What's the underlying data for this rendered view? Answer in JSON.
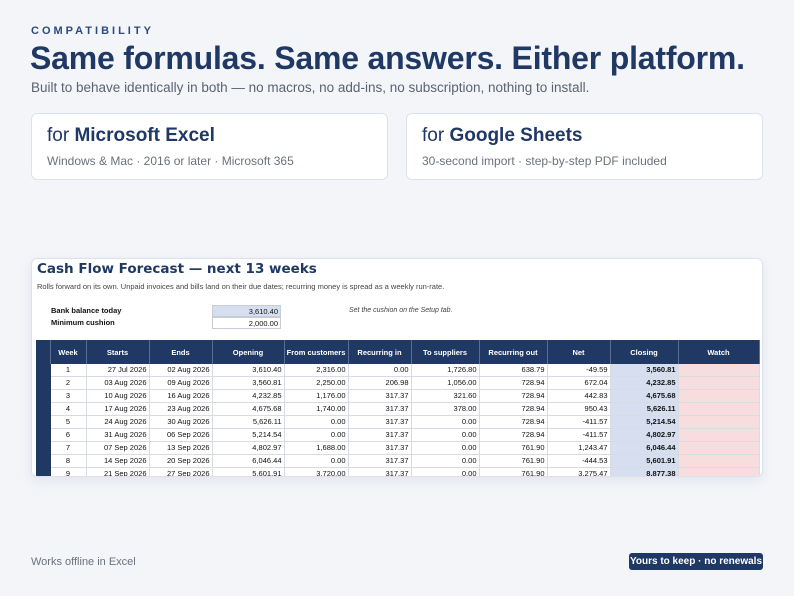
{
  "header": {
    "eyebrow": "COMPATIBILITY",
    "headline": "Same formulas. Same answers. Either platform.",
    "subline": "Built to behave identically in both — no macros, no add-ins, no subscription, nothing to install."
  },
  "cards": [
    {
      "prefix": "for ",
      "product": "Microsoft Excel",
      "sub": "Windows & Mac · 2016 or later · Microsoft 365"
    },
    {
      "prefix": "for ",
      "product": "Google Sheets",
      "sub": "30-second import · step-by-step PDF included"
    }
  ],
  "sheet": {
    "title": "Cash Flow Forecast — next 13 weeks",
    "description": "Rolls forward on its own. Unpaid invoices and bills land on their due dates; recurring money is spread as a weekly run-rate.",
    "bank_balance_label": "Bank balance today",
    "bank_balance_value": "3,610.40",
    "min_cushion_label": "Minimum cushion",
    "min_cushion_value": "2,000.00",
    "note": "Set the cushion on the Setup tab.",
    "columns": [
      "Week",
      "Starts",
      "Ends",
      "Opening",
      "From customers",
      "Recurring in",
      "To suppliers",
      "Recurring out",
      "Net",
      "Closing",
      "Watch"
    ],
    "rows": [
      [
        "1",
        "27 Jul 2026",
        "02 Aug 2026",
        "3,610.40",
        "2,316.00",
        "0.00",
        "1,726.80",
        "638.79",
        "-49.59",
        "3,560.81",
        ""
      ],
      [
        "2",
        "03 Aug 2026",
        "09 Aug 2026",
        "3,560.81",
        "2,250.00",
        "206.98",
        "1,056.00",
        "728.94",
        "672.04",
        "4,232.85",
        ""
      ],
      [
        "3",
        "10 Aug 2026",
        "16 Aug 2026",
        "4,232.85",
        "1,176.00",
        "317.37",
        "321.60",
        "728.94",
        "442.83",
        "4,675.68",
        ""
      ],
      [
        "4",
        "17 Aug 2026",
        "23 Aug 2026",
        "4,675.68",
        "1,740.00",
        "317.37",
        "378.00",
        "728.94",
        "950.43",
        "5,626.11",
        ""
      ],
      [
        "5",
        "24 Aug 2026",
        "30 Aug 2026",
        "5,626.11",
        "0.00",
        "317.37",
        "0.00",
        "728.94",
        "-411.57",
        "5,214.54",
        ""
      ],
      [
        "6",
        "31 Aug 2026",
        "06 Sep 2026",
        "5,214.54",
        "0.00",
        "317.37",
        "0.00",
        "728.94",
        "-411.57",
        "4,802.97",
        ""
      ],
      [
        "7",
        "07 Sep 2026",
        "13 Sep 2026",
        "4,802.97",
        "1,688.00",
        "317.37",
        "0.00",
        "761.90",
        "1,243.47",
        "6,046.44",
        ""
      ],
      [
        "8",
        "14 Sep 2026",
        "20 Sep 2026",
        "6,046.44",
        "0.00",
        "317.37",
        "0.00",
        "761.90",
        "-444.53",
        "5,601.91",
        ""
      ],
      [
        "9",
        "21 Sep 2026",
        "27 Sep 2026",
        "5,601.91",
        "3,720.00",
        "317.37",
        "0.00",
        "761.90",
        "3,275.47",
        "8,877.38",
        ""
      ]
    ]
  },
  "footer": {
    "left": "Works offline in Excel",
    "badge": "Yours to keep · no renewals"
  },
  "colors": {
    "navy": "#1f3864",
    "closing_fill": "#d5dff0",
    "watch_fill": "#f8dddf",
    "background": "#f3f5f9"
  }
}
